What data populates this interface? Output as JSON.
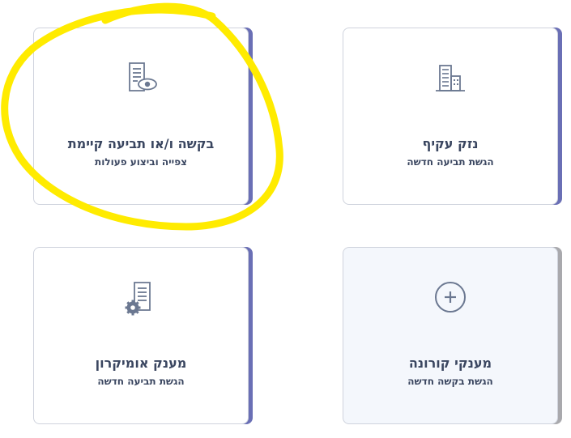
{
  "cards": [
    {
      "title": "בקשה ו/או תביעה קיימת",
      "subtitle": "צפייה וביצוע פעולות",
      "icon": "document-eye-icon"
    },
    {
      "title": "נזק עקיף",
      "subtitle": "הגשת תביעה חדשה",
      "icon": "building-icon"
    },
    {
      "title": "מענק אומיקרון",
      "subtitle": "הגשת תביעה חדשה",
      "icon": "document-gear-icon"
    },
    {
      "title": "מענקי קורונה",
      "subtitle": "הגשת בקשה חדשה",
      "icon": "plus-circle-icon"
    }
  ],
  "colors": {
    "accent": "#6a6fb5",
    "text": "#3a4660",
    "highlight": "#ffeb00"
  }
}
